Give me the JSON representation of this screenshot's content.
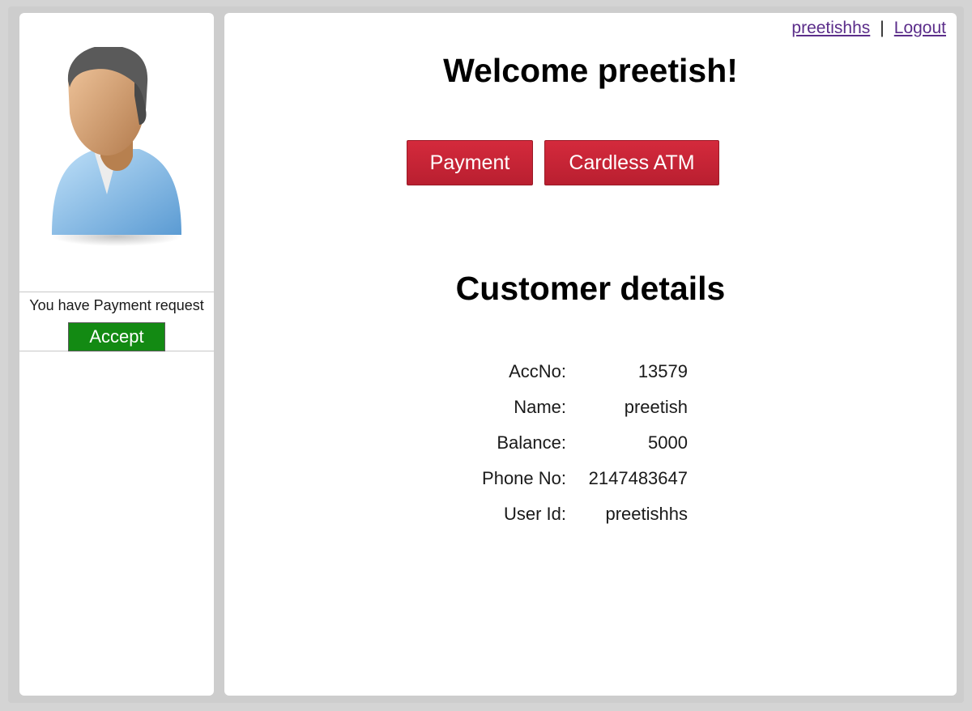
{
  "header": {
    "user_link": "preetishhs",
    "separator": "|",
    "logout_label": "Logout"
  },
  "sidebar": {
    "avatar_icon": "user-avatar-icon",
    "request_text": "You have Payment request",
    "accept_label": "Accept",
    "accept_color": "#138a13"
  },
  "main": {
    "welcome": "Welcome preetish!",
    "buttons": {
      "payment_label": "Payment",
      "cardless_label": "Cardless ATM",
      "button_color": "#c8243a"
    },
    "details_title": "Customer details",
    "details": [
      {
        "label": "AccNo:",
        "value": "13579"
      },
      {
        "label": "Name:",
        "value": "preetish"
      },
      {
        "label": "Balance:",
        "value": "5000"
      },
      {
        "label": "Phone No:",
        "value": "2147483647"
      },
      {
        "label": "User Id:",
        "value": "preetishhs"
      }
    ]
  }
}
